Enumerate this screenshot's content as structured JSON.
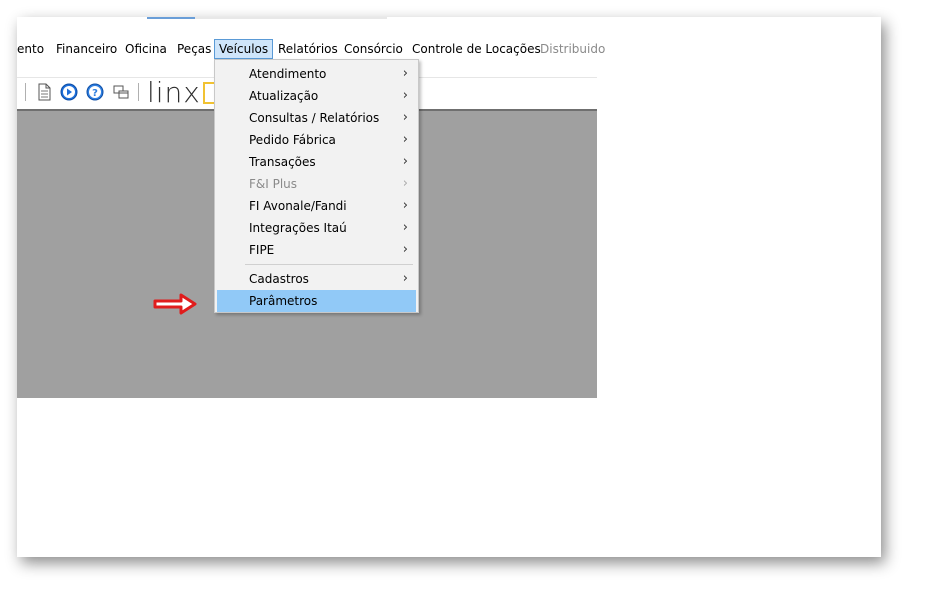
{
  "menubar": {
    "items": [
      {
        "label": "ento",
        "state": "normal"
      },
      {
        "label": "Financeiro",
        "state": "normal"
      },
      {
        "label": "Oficina",
        "state": "normal"
      },
      {
        "label": "Peças",
        "state": "normal"
      },
      {
        "label": "Veículos",
        "state": "open"
      },
      {
        "label": "Relatórios",
        "state": "normal"
      },
      {
        "label": "Consórcio",
        "state": "normal"
      },
      {
        "label": "Controle de Locações",
        "state": "normal"
      },
      {
        "label": "Distribuido",
        "state": "disabled"
      }
    ]
  },
  "toolbar": {
    "icons": [
      "document-icon",
      "play-circle-icon",
      "help-circle-icon",
      "windows-icon"
    ],
    "logo_text": "linx"
  },
  "dropdown": {
    "items": [
      {
        "label": "Atendimento",
        "submenu": true,
        "disabled": false
      },
      {
        "label": "Atualização",
        "submenu": true,
        "disabled": false
      },
      {
        "label": "Consultas / Relatórios",
        "submenu": true,
        "disabled": false
      },
      {
        "label": "Pedido Fábrica",
        "submenu": true,
        "disabled": false
      },
      {
        "label": "Transações",
        "submenu": true,
        "disabled": false
      },
      {
        "label": "F&I Plus",
        "submenu": true,
        "disabled": true
      },
      {
        "label": "FI Avonale/Fandi",
        "submenu": true,
        "disabled": false
      },
      {
        "label": "Integrações Itaú",
        "submenu": true,
        "disabled": false
      },
      {
        "label": "FIPE",
        "submenu": true,
        "disabled": false
      },
      {
        "label": "Cadastros",
        "submenu": true,
        "disabled": false
      },
      {
        "label": "Parâmetros",
        "submenu": false,
        "disabled": false,
        "highlighted": true
      }
    ],
    "submenu_glyph": "›"
  },
  "colors": {
    "highlight": "#91c9f7",
    "menu_open_bg": "#cfe5fa",
    "workspace": "#a0a0a0",
    "arrow": "#e01c1c",
    "logo_accent": "#f1c232"
  }
}
